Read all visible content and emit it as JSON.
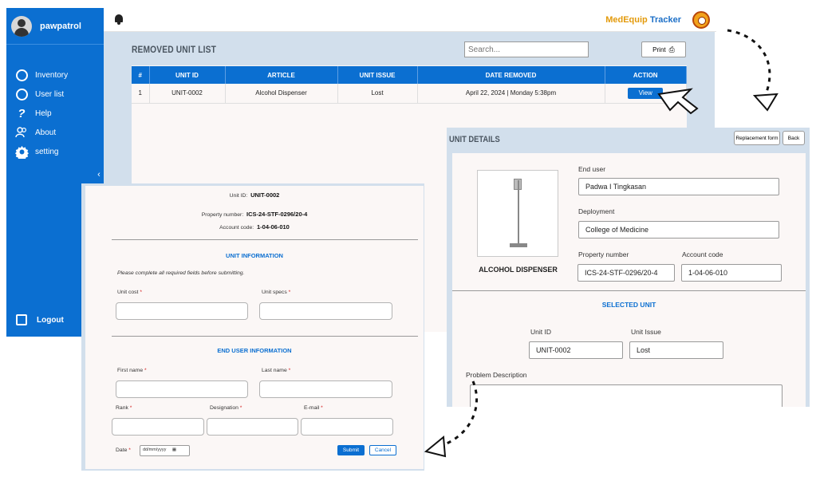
{
  "sidebar": {
    "username": "pawpatrol",
    "items": [
      {
        "label": "Inventory",
        "icon": "inventory-icon"
      },
      {
        "label": "User list",
        "icon": "user-list-icon"
      },
      {
        "label": "Help",
        "icon": "help-icon"
      },
      {
        "label": "About",
        "icon": "about-icon"
      },
      {
        "label": "setting",
        "icon": "gear-icon"
      }
    ],
    "collapse_glyph": "‹",
    "logout_label": "Logout"
  },
  "header": {
    "brand_part1": "MedEquip",
    "brand_part2": "Tracker",
    "brand_color1": "#e39a0b",
    "brand_color2": "#1c6fc7"
  },
  "removed_list": {
    "title": "REMOVED UNIT LIST",
    "search_placeholder": "Search...",
    "print_label": "Print",
    "columns": [
      "#",
      "UNIT ID",
      "ARTICLE",
      "UNIT ISSUE",
      "DATE REMOVED",
      "ACTION"
    ],
    "rows": [
      {
        "num": "1",
        "unit_id": "UNIT-0002",
        "article": "Alcohol Dispenser",
        "issue": "Lost",
        "date": "April 22, 2024 | Monday 5:38pm",
        "action": "View"
      }
    ]
  },
  "unit_details": {
    "title": "UNIT DETAILS",
    "replacement_btn": "Replacement form",
    "back_btn": "Back",
    "equipment_name": "ALCOHOL DISPENSER",
    "end_user_label": "End user",
    "end_user_value": "Padwa  I Tingkasan",
    "deployment_label": "Deployment",
    "deployment_value": "College of Medicine",
    "property_label": "Property number",
    "property_value": "ICS-24-STF-0296/20-4",
    "account_label": "Account code",
    "account_value": "1-04-06-010",
    "selected_title": "SELECTED UNIT",
    "unit_id_label": "Unit ID",
    "unit_id_value": "UNIT-0002",
    "unit_issue_label": "Unit Issue",
    "unit_issue_value": "Lost",
    "problem_label": "Problem Description"
  },
  "replacement_form": {
    "unit_id_label": "Unit ID:",
    "unit_id_value": "UNIT-0002",
    "property_label": "Property number:",
    "property_value": "ICS-24-STF-0296/20-4",
    "account_label": "Account code:",
    "account_value": "1-04-06-010",
    "unit_info_title": "UNIT INFORMATION",
    "note": "Please complete all required fields before submitting.",
    "unit_cost_label": "Unit cost",
    "unit_specs_label": "Unit specs",
    "end_user_title": "END USER INFORMATION",
    "first_name_label": "First name",
    "last_name_label": "Last name",
    "rank_label": "Rank",
    "designation_label": "Designation",
    "email_label": "E-mail",
    "date_label": "Date",
    "date_placeholder": "dd/mm/yyyy",
    "required_mark": "*",
    "submit_label": "Submit",
    "cancel_label": "Cancel"
  }
}
